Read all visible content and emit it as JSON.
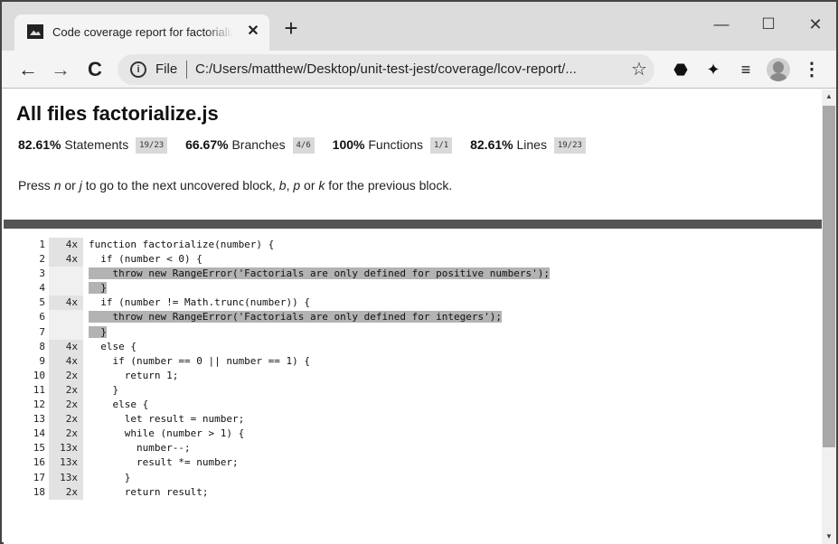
{
  "browser": {
    "tab_title": "Code coverage report for factorialize.js",
    "tab_close": "✕",
    "new_tab": "+",
    "window_controls": {
      "minimize": "—",
      "maximize": "☐",
      "close": "✕"
    },
    "nav": {
      "back": "←",
      "forward": "→",
      "reload": "C"
    },
    "address_bar": {
      "scheme_label": "File",
      "url": "C:/Users/matthew/Desktop/unit-test-jest/coverage/lcov-report/..."
    },
    "icons": {
      "info": "i",
      "star": "☆",
      "extension_1": "⬣",
      "extension_2": "✦",
      "media": "≡",
      "menu": "⋮"
    }
  },
  "report": {
    "title": "All files factorialize.js",
    "stats": [
      {
        "pct": "82.61%",
        "label": "Statements",
        "fraction": "19/23"
      },
      {
        "pct": "66.67%",
        "label": "Branches",
        "fraction": "4/6"
      },
      {
        "pct": "100%",
        "label": "Functions",
        "fraction": "1/1"
      },
      {
        "pct": "82.61%",
        "label": "Lines",
        "fraction": "19/23"
      }
    ],
    "hint": {
      "p1": "Press ",
      "k_n": "n",
      "p2": " or ",
      "k_j": "j",
      "p3": " to go to the next uncovered block, ",
      "k_b": "b",
      "p4": ", ",
      "k_p": "p",
      "p5": " or ",
      "k_k": "k",
      "p6": " for the previous block."
    }
  },
  "code_lines": [
    {
      "num": "1",
      "hits": "4x",
      "pre": "function factorialize(number) {",
      "hl": "",
      "post": ""
    },
    {
      "num": "2",
      "hits": "4x",
      "pre": "  if (number < 0) {",
      "hl": "",
      "post": ""
    },
    {
      "num": "3",
      "hits": "",
      "pre": "",
      "hl": "    throw new RangeError('Factorials are only defined for positive numbers');",
      "post": ""
    },
    {
      "num": "4",
      "hits": "",
      "pre": "",
      "hl": "  }",
      "post": ""
    },
    {
      "num": "5",
      "hits": "4x",
      "pre": "  if (number != Math.trunc(number)) {",
      "hl": "",
      "post": ""
    },
    {
      "num": "6",
      "hits": "",
      "pre": "",
      "hl": "    throw new RangeError('Factorials are only defined for integers');",
      "post": ""
    },
    {
      "num": "7",
      "hits": "",
      "pre": "",
      "hl": "  }",
      "post": ""
    },
    {
      "num": "8",
      "hits": "4x",
      "pre": "  else {",
      "hl": "",
      "post": ""
    },
    {
      "num": "9",
      "hits": "4x",
      "pre": "    if (number == 0 || number == 1) {",
      "hl": "",
      "post": ""
    },
    {
      "num": "10",
      "hits": "2x",
      "pre": "      return 1;",
      "hl": "",
      "post": ""
    },
    {
      "num": "11",
      "hits": "2x",
      "pre": "    }",
      "hl": "",
      "post": ""
    },
    {
      "num": "12",
      "hits": "2x",
      "pre": "    else {",
      "hl": "",
      "post": ""
    },
    {
      "num": "13",
      "hits": "2x",
      "pre": "      let result = number;",
      "hl": "",
      "post": ""
    },
    {
      "num": "14",
      "hits": "2x",
      "pre": "      while (number > 1) {",
      "hl": "",
      "post": ""
    },
    {
      "num": "15",
      "hits": "13x",
      "pre": "        number--;",
      "hl": "",
      "post": ""
    },
    {
      "num": "16",
      "hits": "13x",
      "pre": "        result *= number;",
      "hl": "",
      "post": ""
    },
    {
      "num": "17",
      "hits": "13x",
      "pre": "      }",
      "hl": "",
      "post": ""
    },
    {
      "num": "18",
      "hits": "2x",
      "pre": "      return result;",
      "hl": "",
      "post": ""
    }
  ],
  "scrollbar": {
    "up": "▲",
    "down": "▼"
  }
}
